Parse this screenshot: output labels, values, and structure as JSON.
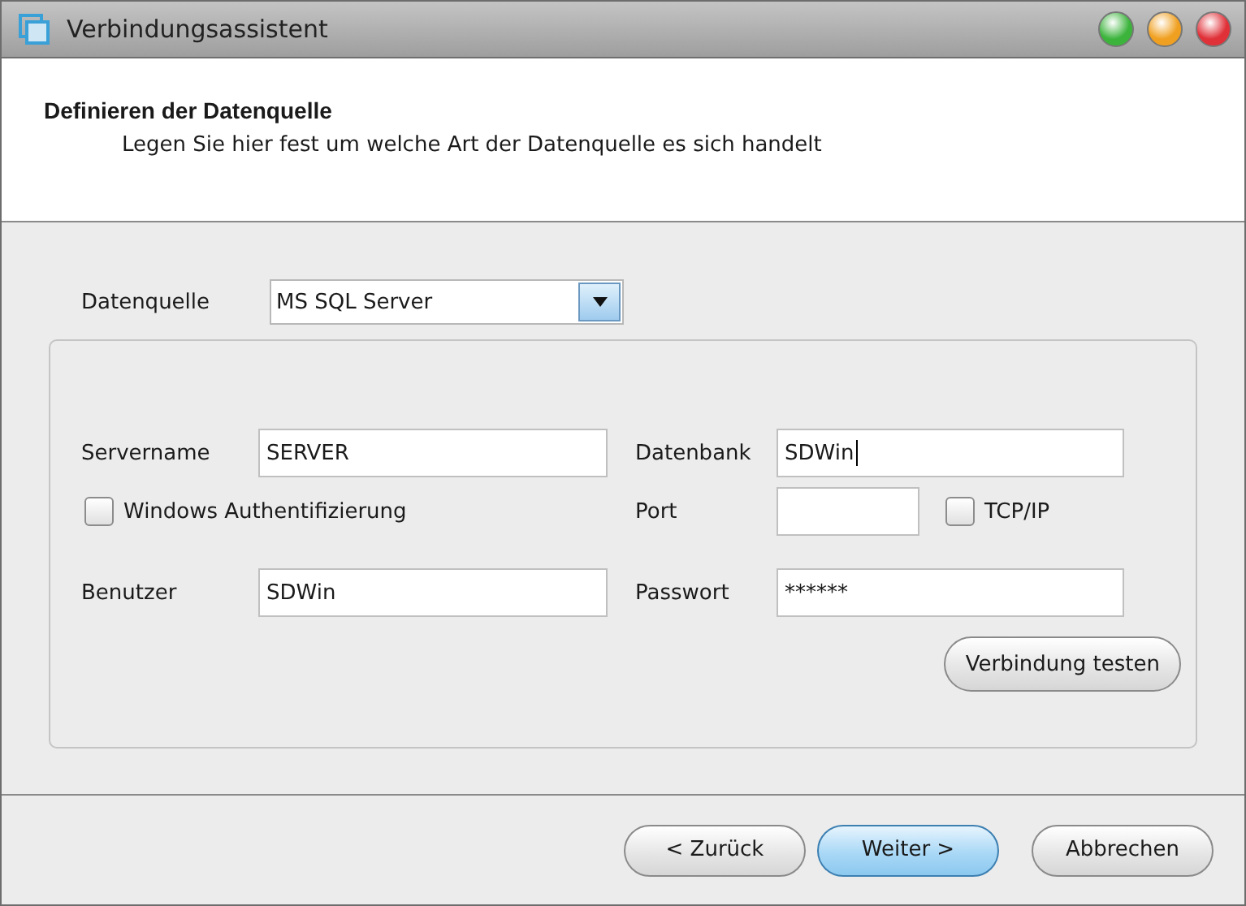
{
  "window": {
    "title": "Verbindungsassistent",
    "controls": [
      {
        "color": "#3cb43c"
      },
      {
        "color": "#f0a020"
      },
      {
        "color": "#e03038"
      }
    ]
  },
  "header": {
    "title": "Definieren der Datenquelle",
    "subtitle": "Legen Sie hier fest um welche Art der Datenquelle es sich handelt"
  },
  "datasource": {
    "label": "Datenquelle",
    "value": "MS SQL Server"
  },
  "left": {
    "server": {
      "label": "Servername",
      "value": "SERVER",
      "focused": false
    },
    "windows_auth": {
      "label": "Windows Authentifizierung",
      "checked": false
    },
    "user": {
      "label": "Benutzer",
      "value": "SDWin",
      "focused": false
    }
  },
  "right": {
    "database": {
      "label": "Datenbank",
      "value": "SDWin",
      "focused": true
    },
    "port": {
      "label": "Port"
    },
    "tcpip": {
      "label": "TCP/IP",
      "checked": false
    },
    "password": {
      "label": "Passwort",
      "value": "******",
      "focused": false
    }
  },
  "test_button": {
    "label": "Verbindung testen"
  },
  "buttons": [
    {
      "label": "< Zurück",
      "default": false
    },
    {
      "label": "Weiter >",
      "default": true
    },
    {
      "label": "Abbrechen",
      "default": false
    }
  ]
}
